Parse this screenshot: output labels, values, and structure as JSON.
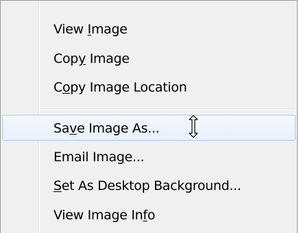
{
  "context_menu": {
    "items": [
      {
        "pre": "View ",
        "key": "I",
        "post": "mage"
      },
      {
        "pre": "Cop",
        "key": "y",
        "post": " Image"
      },
      {
        "pre": "C",
        "key": "o",
        "post": "py Image Location"
      },
      {
        "pre": "Sa",
        "key": "v",
        "post": "e Image As..."
      },
      {
        "pre": "Email Ima",
        "key": "g",
        "post": "e..."
      },
      {
        "pre": "",
        "key": "S",
        "post": "et As Desktop Background..."
      },
      {
        "pre": "View Image In",
        "key": "f",
        "post": "o"
      }
    ],
    "hovered_index": 3,
    "accent_color": "#a8c8ef"
  },
  "cursor": {
    "icon": "text-cursor-icon"
  }
}
